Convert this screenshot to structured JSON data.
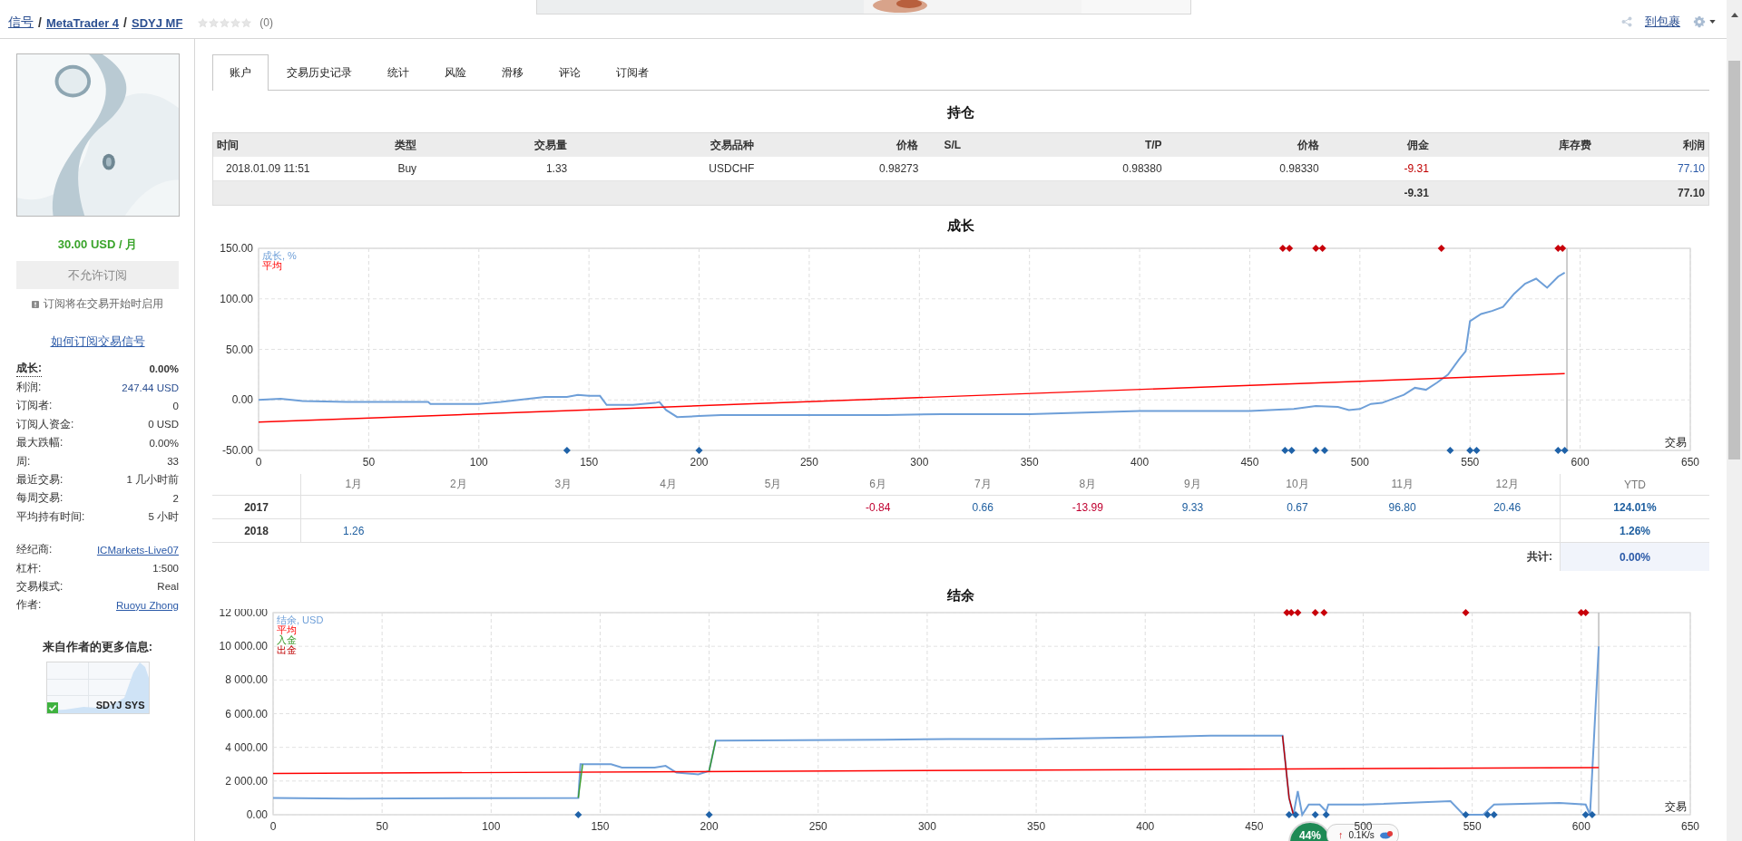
{
  "breadcrumb": {
    "separator": "/",
    "items": [
      {
        "label": "信号",
        "bold": false
      },
      {
        "label": "MetaTrader 4",
        "bold": true
      },
      {
        "label": "SDYJ MF",
        "bold": true
      }
    ]
  },
  "rating": {
    "stars": 0,
    "count": "(0)"
  },
  "top_actions": {
    "link": "到包裹"
  },
  "sidebar": {
    "price": "30.00 USD / 月",
    "subscribe_button": {
      "label": "不允许订阅",
      "disabled": true
    },
    "note": "订阅将在交易开始时启用",
    "help_link": "如何订阅交易信号",
    "stats": [
      {
        "label": "成长:",
        "value": "0.00%",
        "kind": "bold"
      },
      {
        "label": "利润:",
        "value": "247.44 USD",
        "kind": "accent"
      },
      {
        "label": "订阅者:",
        "value": "0",
        "kind": "plain"
      },
      {
        "label": "订阅人资金:",
        "value": "0 USD",
        "kind": "plain"
      },
      {
        "label": "最大跌幅:",
        "value": "0.00%",
        "kind": "plain"
      },
      {
        "label": "周:",
        "value": "33",
        "kind": "plain"
      },
      {
        "label": "最近交易:",
        "value": "1 几小时前",
        "kind": "plain"
      },
      {
        "label": "每周交易:",
        "value": "2",
        "kind": "plain"
      },
      {
        "label": "平均持有时间:",
        "value": "5 小时",
        "kind": "plain"
      }
    ],
    "details": [
      {
        "label": "经纪商:",
        "value": "ICMarkets-Live07",
        "kind": "link"
      },
      {
        "label": "杠杆:",
        "value": "1:500",
        "kind": "plain"
      },
      {
        "label": "交易模式:",
        "value": "Real",
        "kind": "plain"
      },
      {
        "label": "作者:",
        "value": "Ruoyu Zhong",
        "kind": "link"
      }
    ],
    "more_title": "来自作者的更多信息:",
    "more_signal": {
      "name": "SDYJ SYS",
      "active": true
    }
  },
  "tabs": [
    {
      "label": "账户",
      "selected": true
    },
    {
      "label": "交易历史记录",
      "selected": false
    },
    {
      "label": "统计",
      "selected": false
    },
    {
      "label": "风险",
      "selected": false
    },
    {
      "label": "滑移",
      "selected": false
    },
    {
      "label": "评论",
      "selected": false
    },
    {
      "label": "订阅者",
      "selected": false
    }
  ],
  "positions": {
    "title": "持仓",
    "columns": [
      "时间",
      "类型",
      "交易量",
      "交易品种",
      "价格",
      "S/L",
      "T/P",
      "价格",
      "佣金",
      "库存费",
      "利润"
    ],
    "rows": [
      {
        "cells": [
          "2018.01.09 11:51",
          "Buy",
          "1.33",
          "USDCHF",
          "0.98273",
          "",
          "0.98380",
          "0.98330",
          {
            "text": "-9.31",
            "color": "#c00000"
          },
          "",
          {
            "text": "77.10",
            "color": "#2b5aa8"
          }
        ]
      }
    ],
    "totals": {
      "commission": "-9.31",
      "profit": "77.10"
    }
  },
  "growth": {
    "chart_data": {
      "type": "line",
      "title": "成长",
      "xlabel": "交易",
      "xlim": [
        0,
        650
      ],
      "ylim": [
        -50,
        150
      ],
      "grid": true,
      "xticks": [
        0,
        50,
        100,
        150,
        200,
        250,
        300,
        350,
        400,
        450,
        500,
        550,
        600,
        650
      ],
      "yticks": [
        {
          "value": -50,
          "label": "-50.00"
        },
        {
          "value": 0,
          "label": "0.00"
        },
        {
          "value": 50,
          "label": "50.00"
        },
        {
          "value": 100,
          "label": "100.00"
        },
        {
          "value": 150,
          "label": "150.00"
        }
      ],
      "series": [
        {
          "name": "成长, %",
          "color": "#6e9fd8",
          "x": [
            0,
            10,
            20,
            40,
            60,
            77,
            78,
            100,
            110,
            130,
            140,
            145,
            150,
            155,
            158,
            170,
            180,
            182,
            185,
            190,
            200,
            210,
            250,
            285,
            310,
            350,
            400,
            450,
            470,
            480,
            490,
            495,
            500,
            505,
            510,
            520,
            525,
            530,
            535,
            540,
            545,
            548,
            550,
            555,
            560,
            565,
            570,
            575,
            580,
            585,
            590,
            593
          ],
          "values": [
            0,
            1,
            -1,
            -2,
            -2,
            -2,
            -4,
            -4,
            -2,
            3,
            3,
            5,
            4,
            4,
            -5,
            -5,
            -3,
            -2,
            -10,
            -17,
            -16,
            -15,
            -15,
            -15,
            -14,
            -14,
            -11,
            -11,
            -9,
            -6,
            -7,
            -10,
            -9,
            -4,
            -3,
            5,
            12,
            10,
            17,
            25,
            40,
            48,
            78,
            85,
            88,
            92,
            105,
            115,
            120,
            111,
            122,
            126
          ]
        },
        {
          "name": "平均",
          "color": "#ff0000",
          "x": [
            0,
            593
          ],
          "values": [
            -22,
            26
          ]
        },
        {
          "type": "scatter",
          "color": "#c8000a",
          "x": [
            465,
            468,
            480,
            483,
            537,
            590,
            592
          ],
          "values": [
            150,
            150,
            150,
            150,
            150,
            150,
            150
          ]
        },
        {
          "type": "scatter",
          "color": "#1f62a8",
          "x": [
            140,
            200,
            466,
            469,
            480,
            484,
            541,
            550,
            553,
            590,
            593
          ],
          "values": [
            -50,
            -50,
            -50,
            -50,
            -50,
            -50,
            -50,
            -50,
            -50,
            -50,
            -50
          ]
        }
      ],
      "ref_lines": [
        {
          "axis": "x",
          "value": 594
        }
      ]
    }
  },
  "monthly": {
    "columns": [
      "1月",
      "2月",
      "3月",
      "4月",
      "5月",
      "6月",
      "7月",
      "8月",
      "9月",
      "10月",
      "11月",
      "12月",
      "YTD"
    ],
    "rows": [
      {
        "year": "2017",
        "cells": [
          "",
          "",
          "",
          "",
          "",
          {
            "text": "-0.84",
            "color": "#c00030"
          },
          {
            "text": "0.66",
            "color": "#1f5fa0"
          },
          {
            "text": "-13.99",
            "color": "#c00030"
          },
          {
            "text": "9.33",
            "color": "#1f5fa0"
          },
          {
            "text": "0.67",
            "color": "#1f5fa0"
          },
          {
            "text": "96.80",
            "color": "#1f5fa0"
          },
          {
            "text": "20.46",
            "color": "#1f5fa0"
          },
          {
            "text": "124.01%",
            "color": "#1f5fa0"
          }
        ]
      },
      {
        "year": "2018",
        "cells": [
          {
            "text": "1.26",
            "color": "#1f5fa0"
          },
          "",
          "",
          "",
          "",
          "",
          "",
          "",
          "",
          "",
          "",
          "",
          {
            "text": "1.26%",
            "color": "#1f5fa0"
          }
        ]
      }
    ],
    "total_label": "共计:",
    "total_value": "0.00%"
  },
  "balance": {
    "chart_data": {
      "type": "line",
      "title": "结余",
      "xlabel": "交易",
      "xlim": [
        0,
        650
      ],
      "ylim": [
        0,
        12000
      ],
      "grid": true,
      "xticks": [
        0,
        50,
        100,
        150,
        200,
        250,
        300,
        350,
        400,
        450,
        500,
        550,
        600,
        650
      ],
      "yticks": [
        {
          "value": 0,
          "label": "0.00"
        },
        {
          "value": 2000,
          "label": "2 000.00"
        },
        {
          "value": 4000,
          "label": "4 000.00"
        },
        {
          "value": 6000,
          "label": "6 000.00"
        },
        {
          "value": 8000,
          "label": "8 000.00"
        },
        {
          "value": 10000,
          "label": "10 000.00"
        },
        {
          "value": 12000,
          "label": "12 000.00"
        }
      ],
      "series": [
        {
          "name": "结余, USD",
          "color": "#6e9fd8",
          "x": [
            0,
            35,
            140,
            141,
            155,
            160,
            175,
            180,
            185,
            195,
            200,
            203,
            280,
            310,
            350,
            400,
            430,
            463,
            466,
            468,
            470,
            472,
            475,
            480,
            483,
            484,
            500,
            540,
            546,
            555,
            560,
            590,
            602,
            604,
            606,
            608
          ],
          "values": [
            1000,
            950,
            1000,
            3000,
            3000,
            2800,
            2800,
            2900,
            2500,
            2400,
            2600,
            4400,
            4450,
            4500,
            4500,
            4600,
            4700,
            4700,
            1000,
            0,
            1400,
            0,
            600,
            600,
            200,
            600,
            600,
            800,
            0,
            0,
            600,
            700,
            600,
            0,
            5000,
            10000
          ]
        },
        {
          "name": "平均",
          "color": "#ff0000",
          "x": [
            0,
            608
          ],
          "values": [
            2450,
            2800
          ]
        },
        {
          "name": "入金",
          "color": "#3a9a2a",
          "x": [
            140,
            142,
            null,
            200,
            203
          ],
          "values": [
            1000,
            3000,
            null,
            2600,
            4400
          ]
        },
        {
          "name": "出金",
          "color": "#c00000",
          "x": [
            463,
            466,
            468
          ],
          "values": [
            4700,
            1000,
            0
          ]
        },
        {
          "type": "scatter",
          "color": "#c8000a",
          "x": [
            465,
            467,
            470,
            478,
            482,
            547,
            600,
            602
          ],
          "values": [
            12000,
            12000,
            12000,
            12000,
            12000,
            12000,
            12000,
            12000
          ]
        },
        {
          "type": "scatter",
          "color": "#1f62a8",
          "x": [
            140,
            200,
            466,
            469,
            478,
            483,
            547,
            557,
            560,
            602,
            605
          ],
          "values": [
            0,
            0,
            0,
            0,
            0,
            0,
            0,
            0,
            0,
            0,
            0
          ]
        }
      ],
      "ref_lines": [
        {
          "axis": "x",
          "value": 608
        }
      ]
    }
  },
  "net_widget": {
    "cpu": "44%",
    "upload_arrow": "↑",
    "speed": "0.1K/s"
  }
}
